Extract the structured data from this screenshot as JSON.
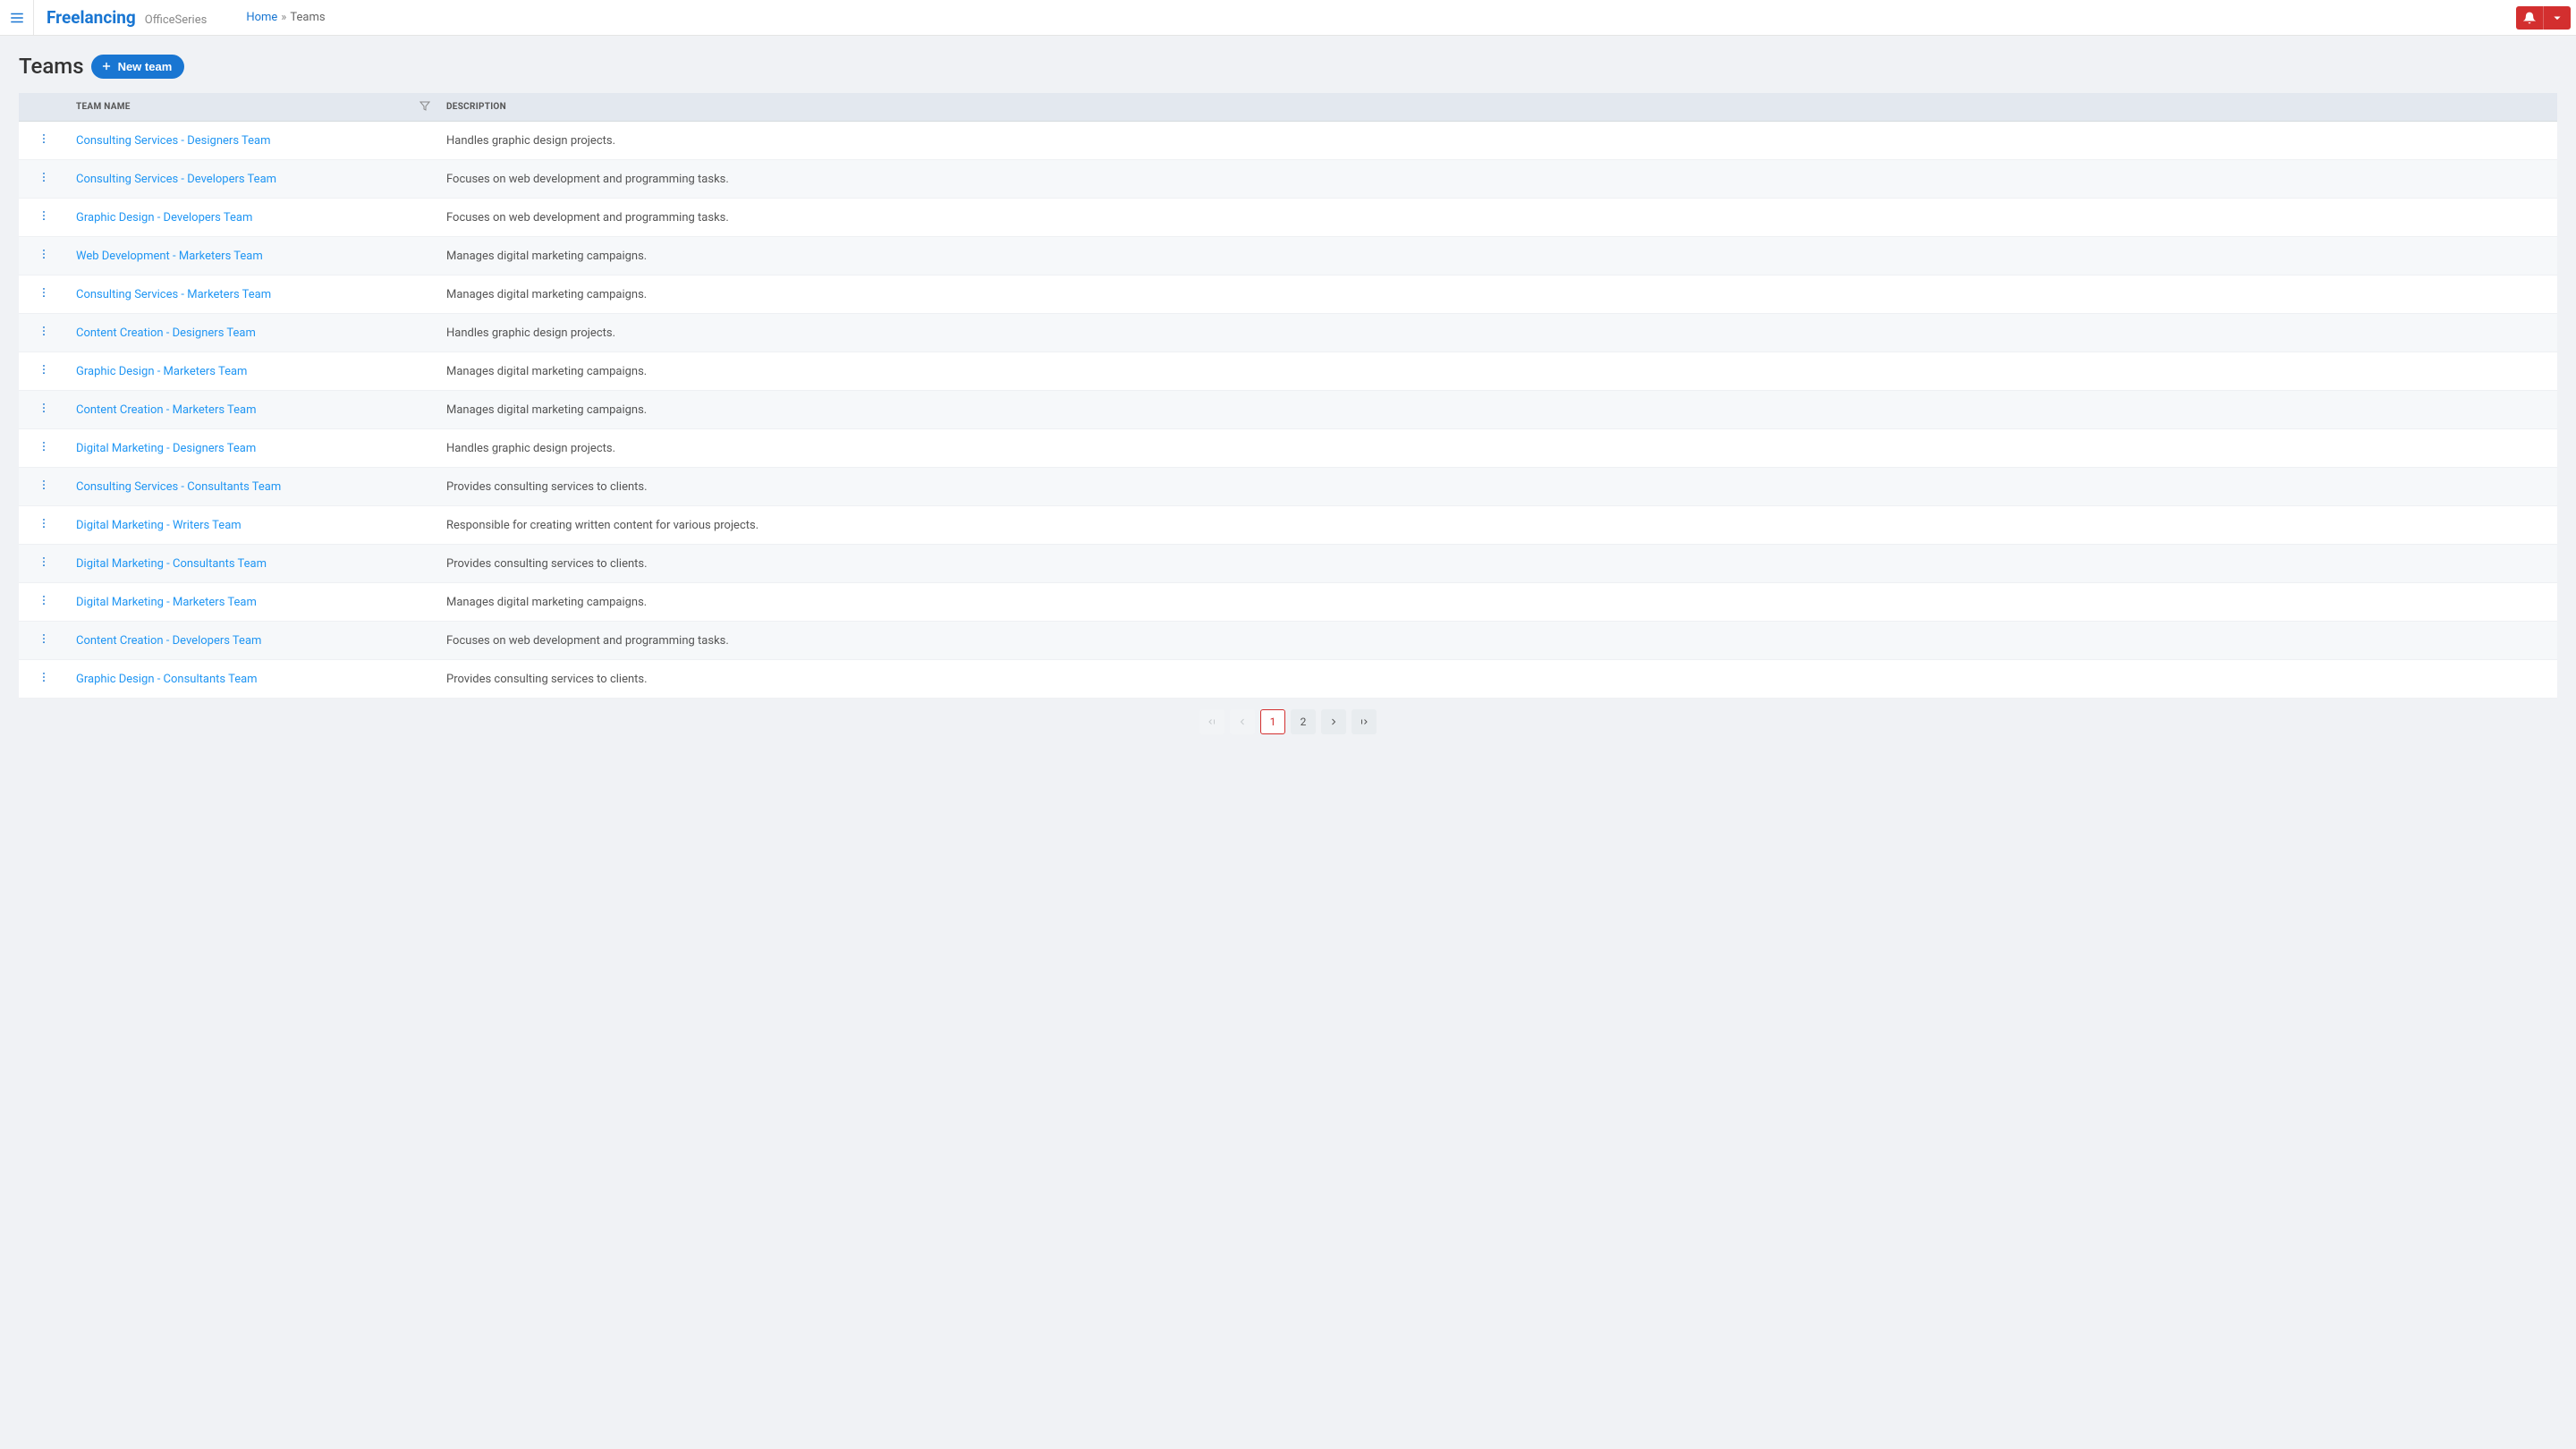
{
  "header": {
    "brand": "Freelancing",
    "brand_sub": "OfficeSeries",
    "breadcrumbs": {
      "home": "Home",
      "current": "Teams"
    }
  },
  "page": {
    "title": "Teams",
    "new_button": "New team"
  },
  "table": {
    "columns": {
      "name": "Team Name",
      "description": "Description"
    },
    "rows": [
      {
        "name": "Consulting Services - Designers Team",
        "description": "Handles graphic design projects."
      },
      {
        "name": "Consulting Services - Developers Team",
        "description": "Focuses on web development and programming tasks."
      },
      {
        "name": "Graphic Design - Developers Team",
        "description": "Focuses on web development and programming tasks."
      },
      {
        "name": "Web Development - Marketers Team",
        "description": "Manages digital marketing campaigns."
      },
      {
        "name": "Consulting Services - Marketers Team",
        "description": "Manages digital marketing campaigns."
      },
      {
        "name": "Content Creation - Designers Team",
        "description": "Handles graphic design projects."
      },
      {
        "name": "Graphic Design - Marketers Team",
        "description": "Manages digital marketing campaigns."
      },
      {
        "name": "Content Creation - Marketers Team",
        "description": "Manages digital marketing campaigns."
      },
      {
        "name": "Digital Marketing - Designers Team",
        "description": "Handles graphic design projects."
      },
      {
        "name": "Consulting Services - Consultants Team",
        "description": "Provides consulting services to clients."
      },
      {
        "name": "Digital Marketing - Writers Team",
        "description": "Responsible for creating written content for various projects."
      },
      {
        "name": "Digital Marketing - Consultants Team",
        "description": "Provides consulting services to clients."
      },
      {
        "name": "Digital Marketing - Marketers Team",
        "description": "Manages digital marketing campaigns."
      },
      {
        "name": "Content Creation - Developers Team",
        "description": "Focuses on web development and programming tasks."
      },
      {
        "name": "Graphic Design - Consultants Team",
        "description": "Provides consulting services to clients."
      }
    ]
  },
  "pagination": {
    "pages": [
      "1",
      "2"
    ],
    "current": "1"
  }
}
